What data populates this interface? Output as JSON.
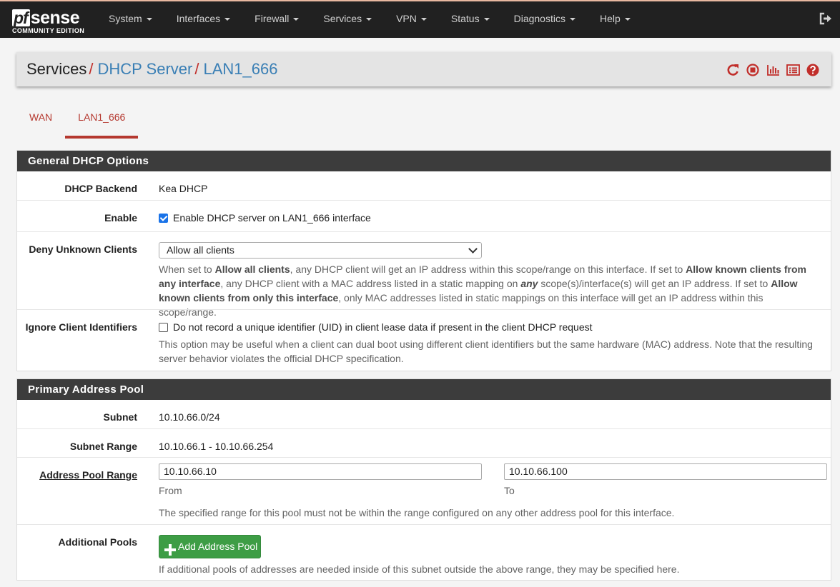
{
  "logo": {
    "pf": "pf",
    "sense": "sense",
    "edition": "COMMUNITY EDITION"
  },
  "nav": {
    "items": [
      "System",
      "Interfaces",
      "Firewall",
      "Services",
      "VPN",
      "Status",
      "Diagnostics",
      "Help"
    ],
    "logout_icon": "logout-icon"
  },
  "breadcrumb": {
    "root": "Services",
    "sep": "/",
    "level2": "DHCP Server",
    "level3": "LAN1_666"
  },
  "header_icons": [
    "restart-icon",
    "stop-icon",
    "chart-icon",
    "list-icon",
    "help-icon"
  ],
  "tabs": [
    {
      "label": "WAN",
      "active": false
    },
    {
      "label": "LAN1_666",
      "active": true
    }
  ],
  "general": {
    "title": "General DHCP Options",
    "backend_label": "DHCP Backend",
    "backend_value": "Kea DHCP",
    "enable_label": "Enable",
    "enable_text": "Enable DHCP server on LAN1_666 interface",
    "enable_checked": true,
    "deny_label": "Deny Unknown Clients",
    "deny_value": "Allow all clients",
    "deny_help": {
      "p1": "When set to ",
      "b1": "Allow all clients",
      "p2": ", any DHCP client will get an IP address within this scope/range on this interface. If set to ",
      "b2": "Allow known clients from any interface",
      "p3": ", any DHCP client with a MAC address listed in a static mapping on ",
      "b3": "any",
      "p4": " scope(s)/interface(s) will get an IP address. If set to ",
      "b4": "Allow known clients from only this interface",
      "p5": ", only MAC addresses listed in static mappings on this interface will get an IP address within this scope/range."
    },
    "ignore_label": "Ignore Client Identifiers",
    "ignore_text": "Do not record a unique identifier (UID) in client lease data if present in the client DHCP request",
    "ignore_checked": false,
    "ignore_help": "This option may be useful when a client can dual boot using different client identifiers but the same hardware (MAC) address. Note that the resulting server behavior violates the official DHCP specification."
  },
  "pool": {
    "title": "Primary Address Pool",
    "subnet_label": "Subnet",
    "subnet_value": "10.10.66.0/24",
    "range_label": "Subnet Range",
    "range_value": "10.10.66.1 - 10.10.66.254",
    "pool_range_label": "Address Pool Range",
    "from_value": "10.10.66.10",
    "from_label": "From",
    "to_value": "10.10.66.100",
    "to_label": "To",
    "pool_help": "The specified range for this pool must not be within the range configured on any other address pool for this interface.",
    "additional_label": "Additional Pools",
    "add_button": "Add Address Pool",
    "additional_help": "If additional pools of addresses are needed inside of this subnet outside the above range, they may be specified here."
  },
  "colors": {
    "accent_red": "#b5382f",
    "link_blue": "#3a7fb5",
    "navbar": "#212121",
    "button_green": "#3d9d45"
  }
}
